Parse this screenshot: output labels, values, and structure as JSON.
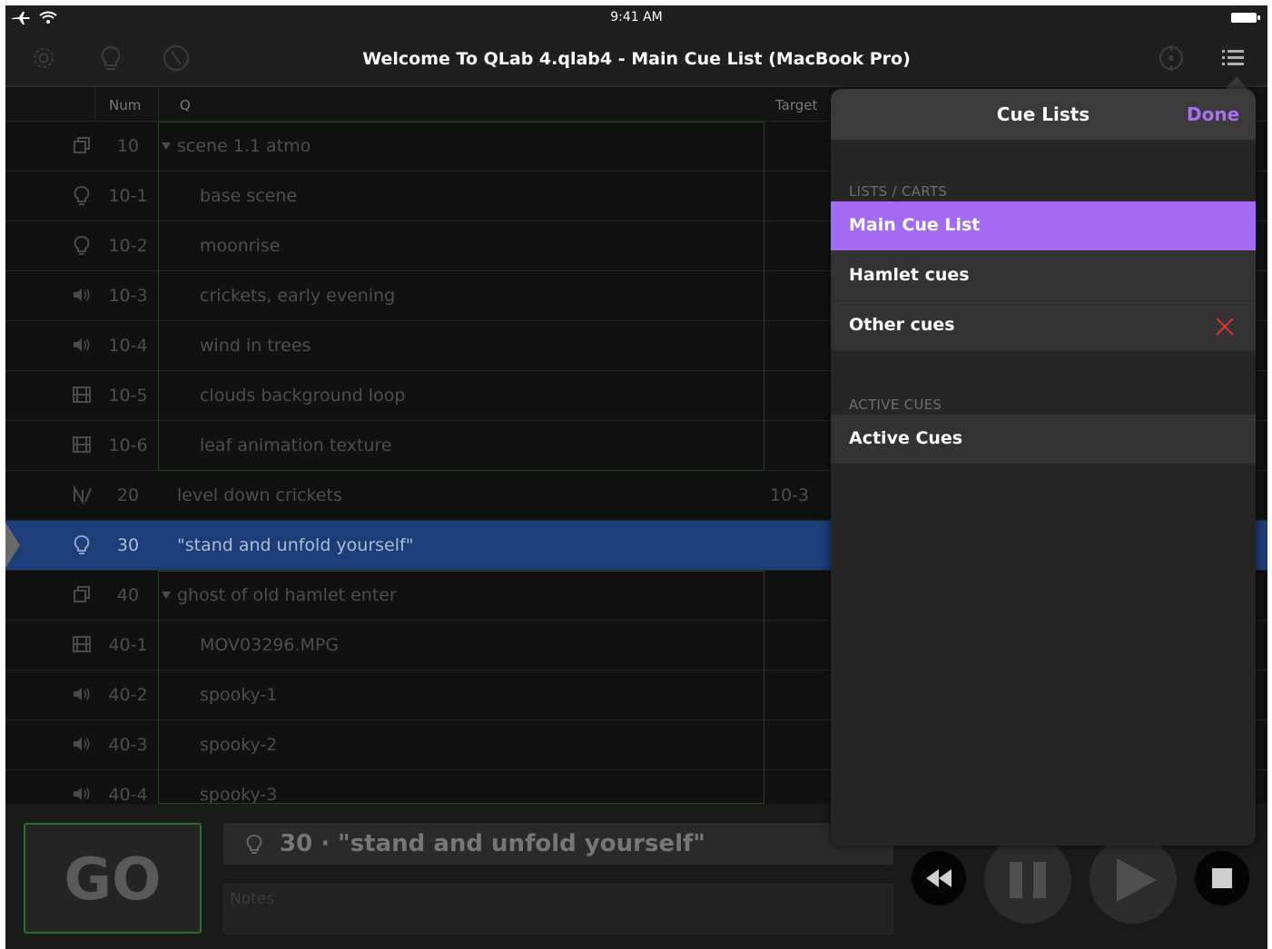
{
  "status_bar": {
    "time": "9:41 AM"
  },
  "window": {
    "title": "Welcome To QLab 4.qlab4 - Main Cue List (MacBook Pro)"
  },
  "columns": {
    "num": "Num",
    "q": "Q",
    "target": "Target"
  },
  "rows": [
    {
      "num": "10",
      "name": "scene 1.1 atmo",
      "type": "group-icon",
      "indent": 0,
      "expanded": true,
      "target": ""
    },
    {
      "num": "10-1",
      "name": "base scene",
      "type": "light-icon",
      "indent": 1,
      "target": ""
    },
    {
      "num": "10-2",
      "name": "moonrise",
      "type": "light-icon",
      "indent": 1,
      "target": ""
    },
    {
      "num": "10-3",
      "name": "crickets, early evening",
      "type": "audio-icon",
      "indent": 1,
      "target": ""
    },
    {
      "num": "10-4",
      "name": "wind in trees",
      "type": "audio-icon",
      "indent": 1,
      "target": ""
    },
    {
      "num": "10-5",
      "name": "clouds background loop",
      "type": "video-icon",
      "indent": 1,
      "target": ""
    },
    {
      "num": "10-6",
      "name": "leaf animation texture",
      "type": "video-icon",
      "indent": 1,
      "target": ""
    },
    {
      "num": "20",
      "name": "level down crickets",
      "type": "fade-icon",
      "indent": 0,
      "target": "10-3"
    },
    {
      "num": "30",
      "name": "\"stand and unfold yourself\"",
      "type": "light-icon",
      "indent": 0,
      "target": "",
      "selected": true
    },
    {
      "num": "40",
      "name": "ghost of old hamlet enter",
      "type": "group-icon",
      "indent": 0,
      "expanded": true,
      "target": ""
    },
    {
      "num": "40-1",
      "name": "MOV03296.MPG",
      "type": "video-icon",
      "indent": 1,
      "target": ""
    },
    {
      "num": "40-2",
      "name": "spooky-1",
      "type": "audio-icon",
      "indent": 1,
      "target": ""
    },
    {
      "num": "40-3",
      "name": "spooky-2",
      "type": "audio-icon",
      "indent": 1,
      "target": ""
    },
    {
      "num": "40-4",
      "name": "spooky-3",
      "type": "audio-icon",
      "indent": 1,
      "target": ""
    }
  ],
  "bottom": {
    "go_label": "GO",
    "standby": "30 · \"stand and unfold yourself\"",
    "notes_placeholder": "Notes"
  },
  "popover": {
    "title": "Cue Lists",
    "done": "Done",
    "section_lists": "LISTS / CARTS",
    "lists": [
      {
        "label": "Main Cue List",
        "selected": true
      },
      {
        "label": "Hamlet cues"
      },
      {
        "label": "Other cues",
        "deletable": true
      }
    ],
    "section_active": "ACTIVE CUES",
    "active": [
      {
        "label": "Active Cues"
      }
    ]
  },
  "colors": {
    "accent": "#a26bf2",
    "selection": "#1c3d78",
    "go_border": "#2e6b2e",
    "delete": "#e0323c"
  }
}
